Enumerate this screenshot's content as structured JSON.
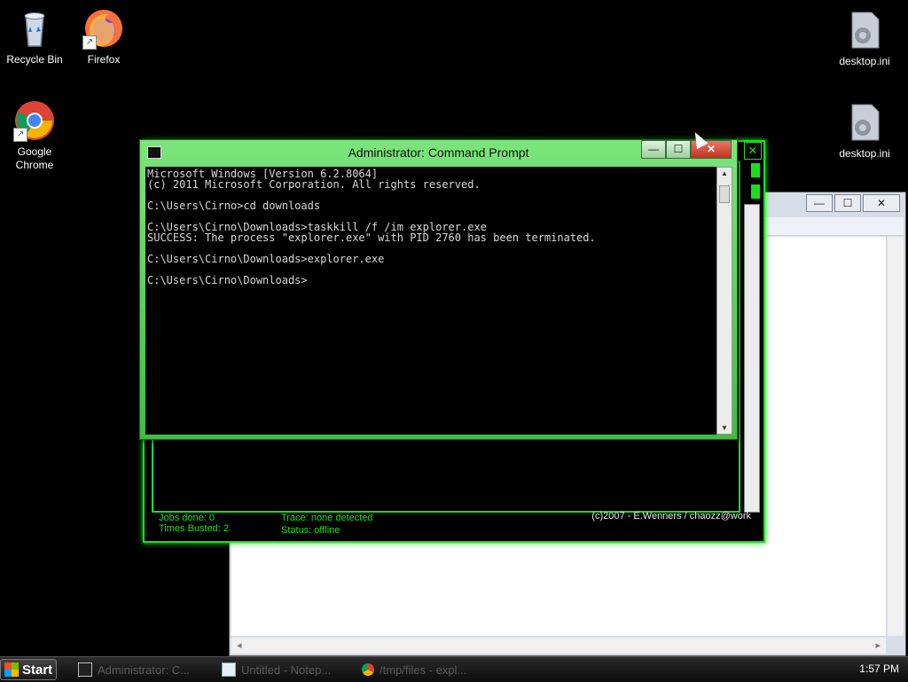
{
  "desktop": {
    "icons": [
      {
        "label": "Recycle Bin"
      },
      {
        "label": "Firefox"
      },
      {
        "label": "Google Chrome"
      },
      {
        "label": "desktop.ini"
      },
      {
        "label": "desktop.ini"
      }
    ]
  },
  "cmd": {
    "title": "Administrator: Command Prompt",
    "console": "Microsoft Windows [Version 6.2.8064]\n(c) 2011 Microsoft Corporation. All rights reserved.\n\nC:\\Users\\Cirno>cd downloads\n\nC:\\Users\\Cirno\\Downloads>taskkill /f /im explorer.exe\nSUCCESS: The process \"explorer.exe\" with PID 2760 has been terminated.\n\nC:\\Users\\Cirno\\Downloads>explorer.exe\n\nC:\\Users\\Cirno\\Downloads>"
  },
  "green_window": {
    "jobs_done": "Jobs done: 0",
    "times_busted": "Times Busted: 2",
    "trace": "Trace: none detected",
    "status": "Status: offline",
    "credit": "(c)2007 - E.Wenners / chaozz@work"
  },
  "taskbar": {
    "start_label": "Start",
    "tasks": [
      {
        "label": "Administrator: C..."
      },
      {
        "label": "Untitled - Notep..."
      },
      {
        "label": "/tmp/files - expl..."
      }
    ],
    "clock": "1:57 PM"
  },
  "colors": {
    "green_accent": "#19e019",
    "desktop_bg": "#000000"
  }
}
